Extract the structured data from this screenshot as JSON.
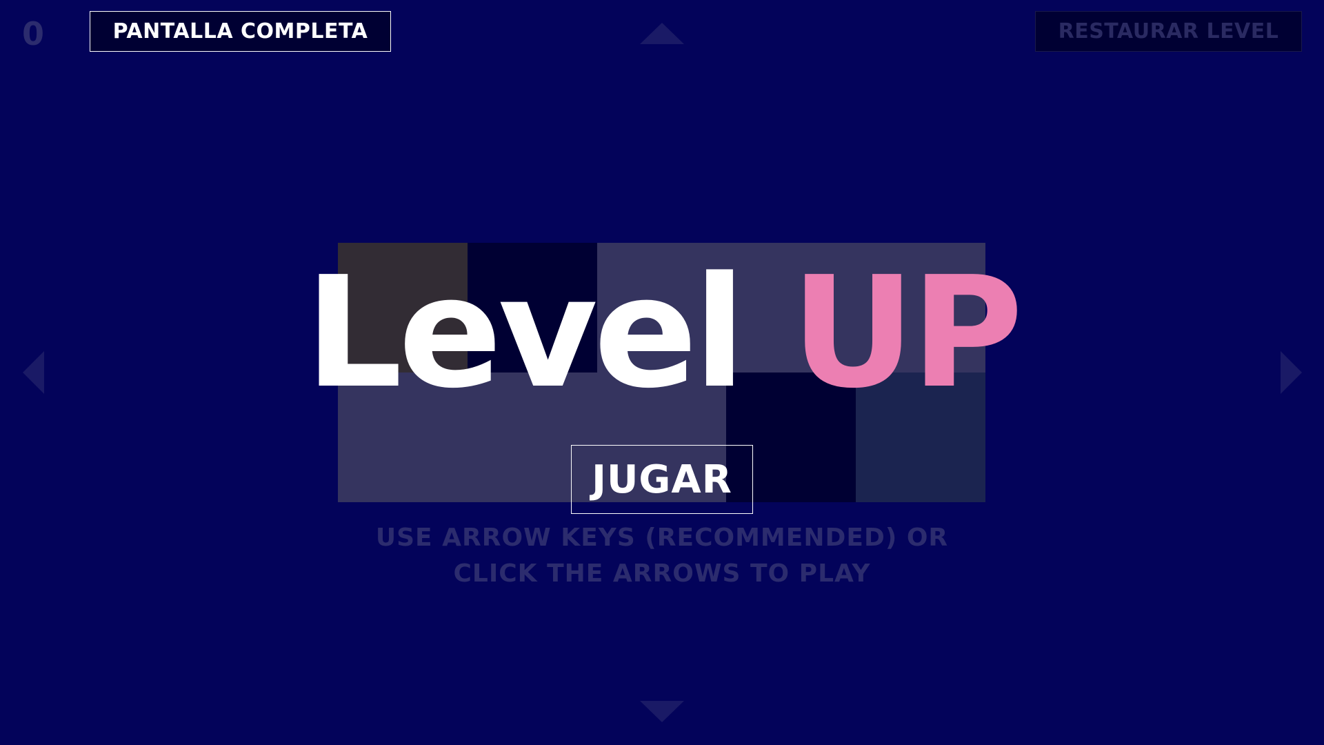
{
  "hud": {
    "score": "0",
    "fullscreen_label": "PANTALLA COMPLETA",
    "restore_label": "RESTAURAR LEVEL"
  },
  "controls": {
    "up_icon": "arrow-up-icon",
    "down_icon": "arrow-down-icon",
    "left_icon": "arrow-left-icon",
    "right_icon": "arrow-right-icon"
  },
  "title": {
    "word1": "Level",
    "word2": "UP",
    "word1_color": "#ffffff",
    "word2_color": "#ec7fb2"
  },
  "play_label": "JUGAR",
  "instructions": {
    "line1": "USE ARROW KEYS (RECOMMENDED) OR",
    "line2": "CLICK THE ARROWS TO PLAY"
  },
  "board": {
    "tiles": [
      {
        "color": "#322c34"
      },
      {
        "color": "#000033"
      },
      {
        "color": "#35345f"
      },
      {
        "color": "#35345f"
      },
      {
        "color": "#000033"
      },
      {
        "color": "#1b2450"
      }
    ]
  },
  "colors": {
    "background": "#03035a",
    "accent": "#ec7fb2",
    "muted_text": "#2c2c6e"
  }
}
